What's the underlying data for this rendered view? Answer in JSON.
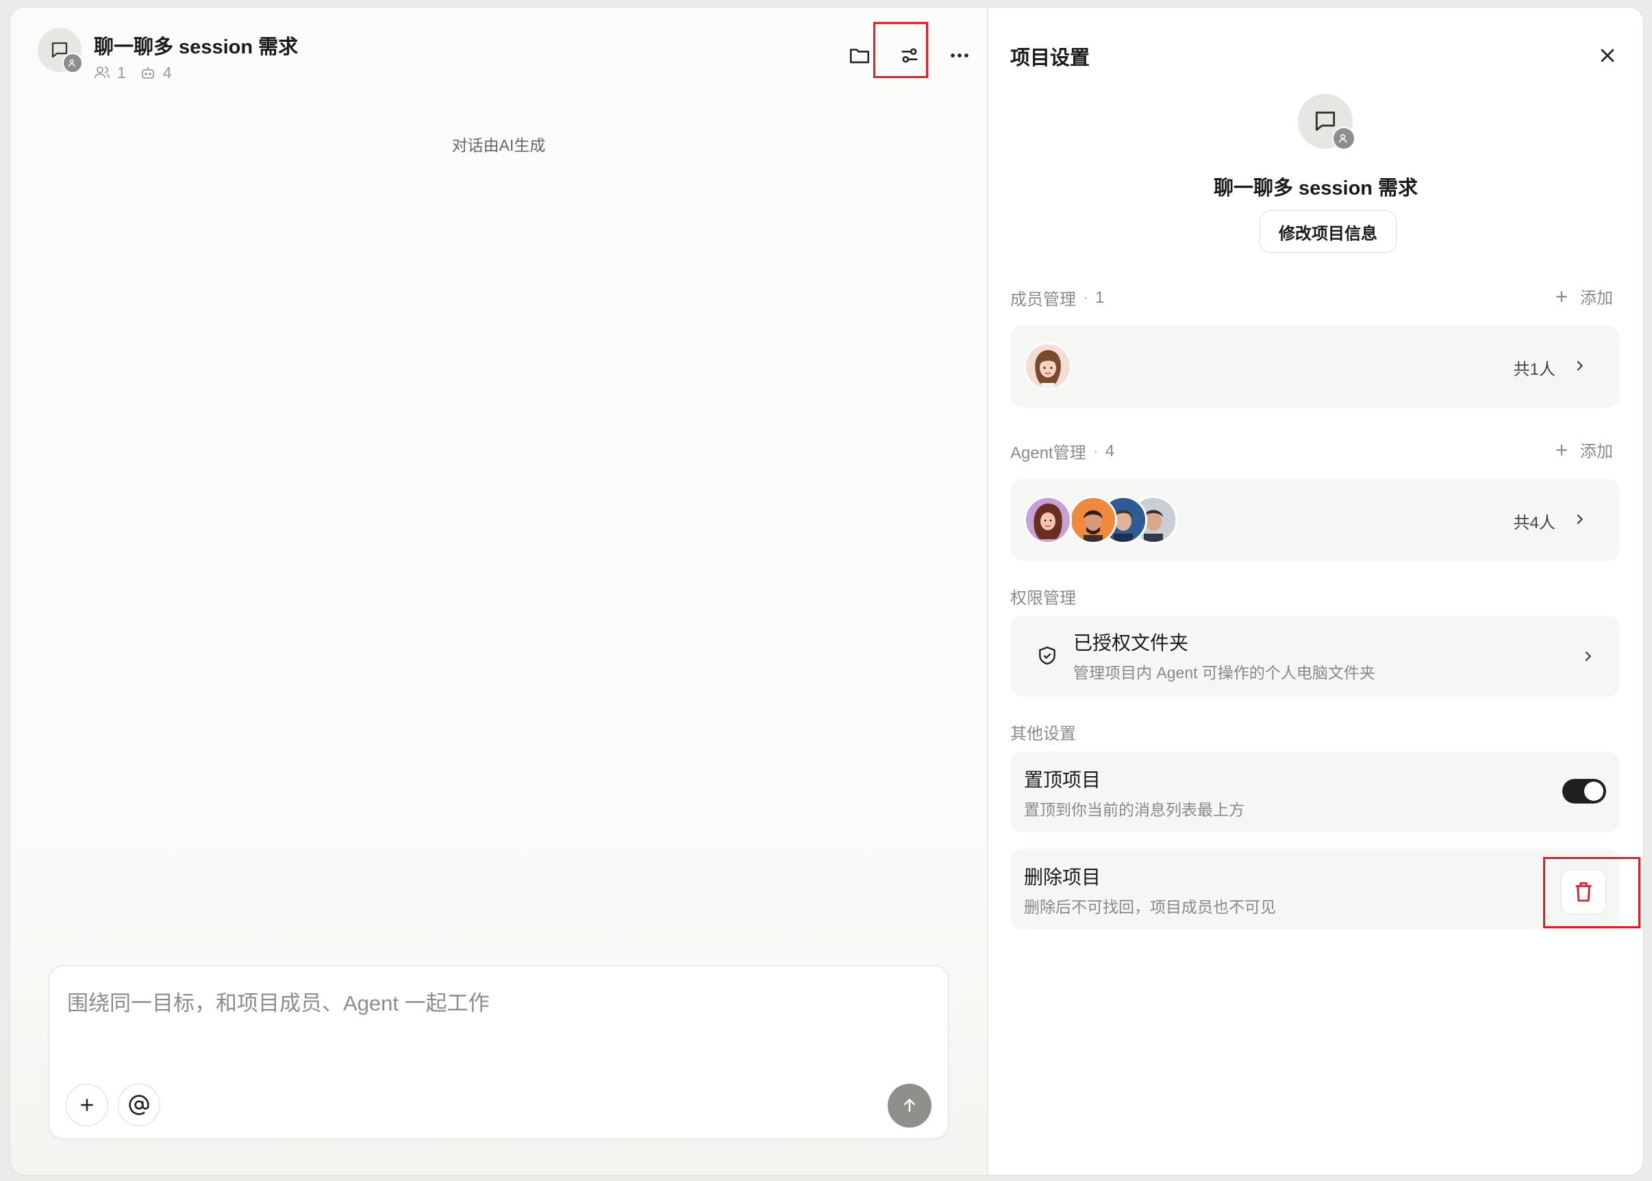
{
  "chat": {
    "title": "聊一聊多 session 需求",
    "member_count": "1",
    "agent_count": "4",
    "ai_note": "对话由AI生成",
    "composer_placeholder": "围绕同一目标，和项目成员、Agent 一起工作"
  },
  "settings": {
    "title": "项目设置",
    "project_name": "聊一聊多 session 需求",
    "edit_button": "修改项目信息",
    "members": {
      "label": "成员管理",
      "count": "1",
      "add": "添加",
      "total": "共1人"
    },
    "agents": {
      "label": "Agent管理",
      "count": "4",
      "add": "添加",
      "total": "共4人"
    },
    "permissions": {
      "label": "权限管理",
      "folder_title": "已授权文件夹",
      "folder_sub": "管理项目内 Agent 可操作的个人电脑文件夹"
    },
    "other": {
      "label": "其他设置",
      "pin_title": "置顶项目",
      "pin_sub": "置顶到你当前的消息列表最上方",
      "pin_enabled": true,
      "delete_title": "删除项目",
      "delete_sub": "删除后不可找回，项目成员也不可见"
    }
  },
  "colors": {
    "highlight": "#e21d25",
    "toggle_on": "#1f1f1f",
    "delete_icon": "#d8232a",
    "send_button": "#8f8f8c"
  }
}
